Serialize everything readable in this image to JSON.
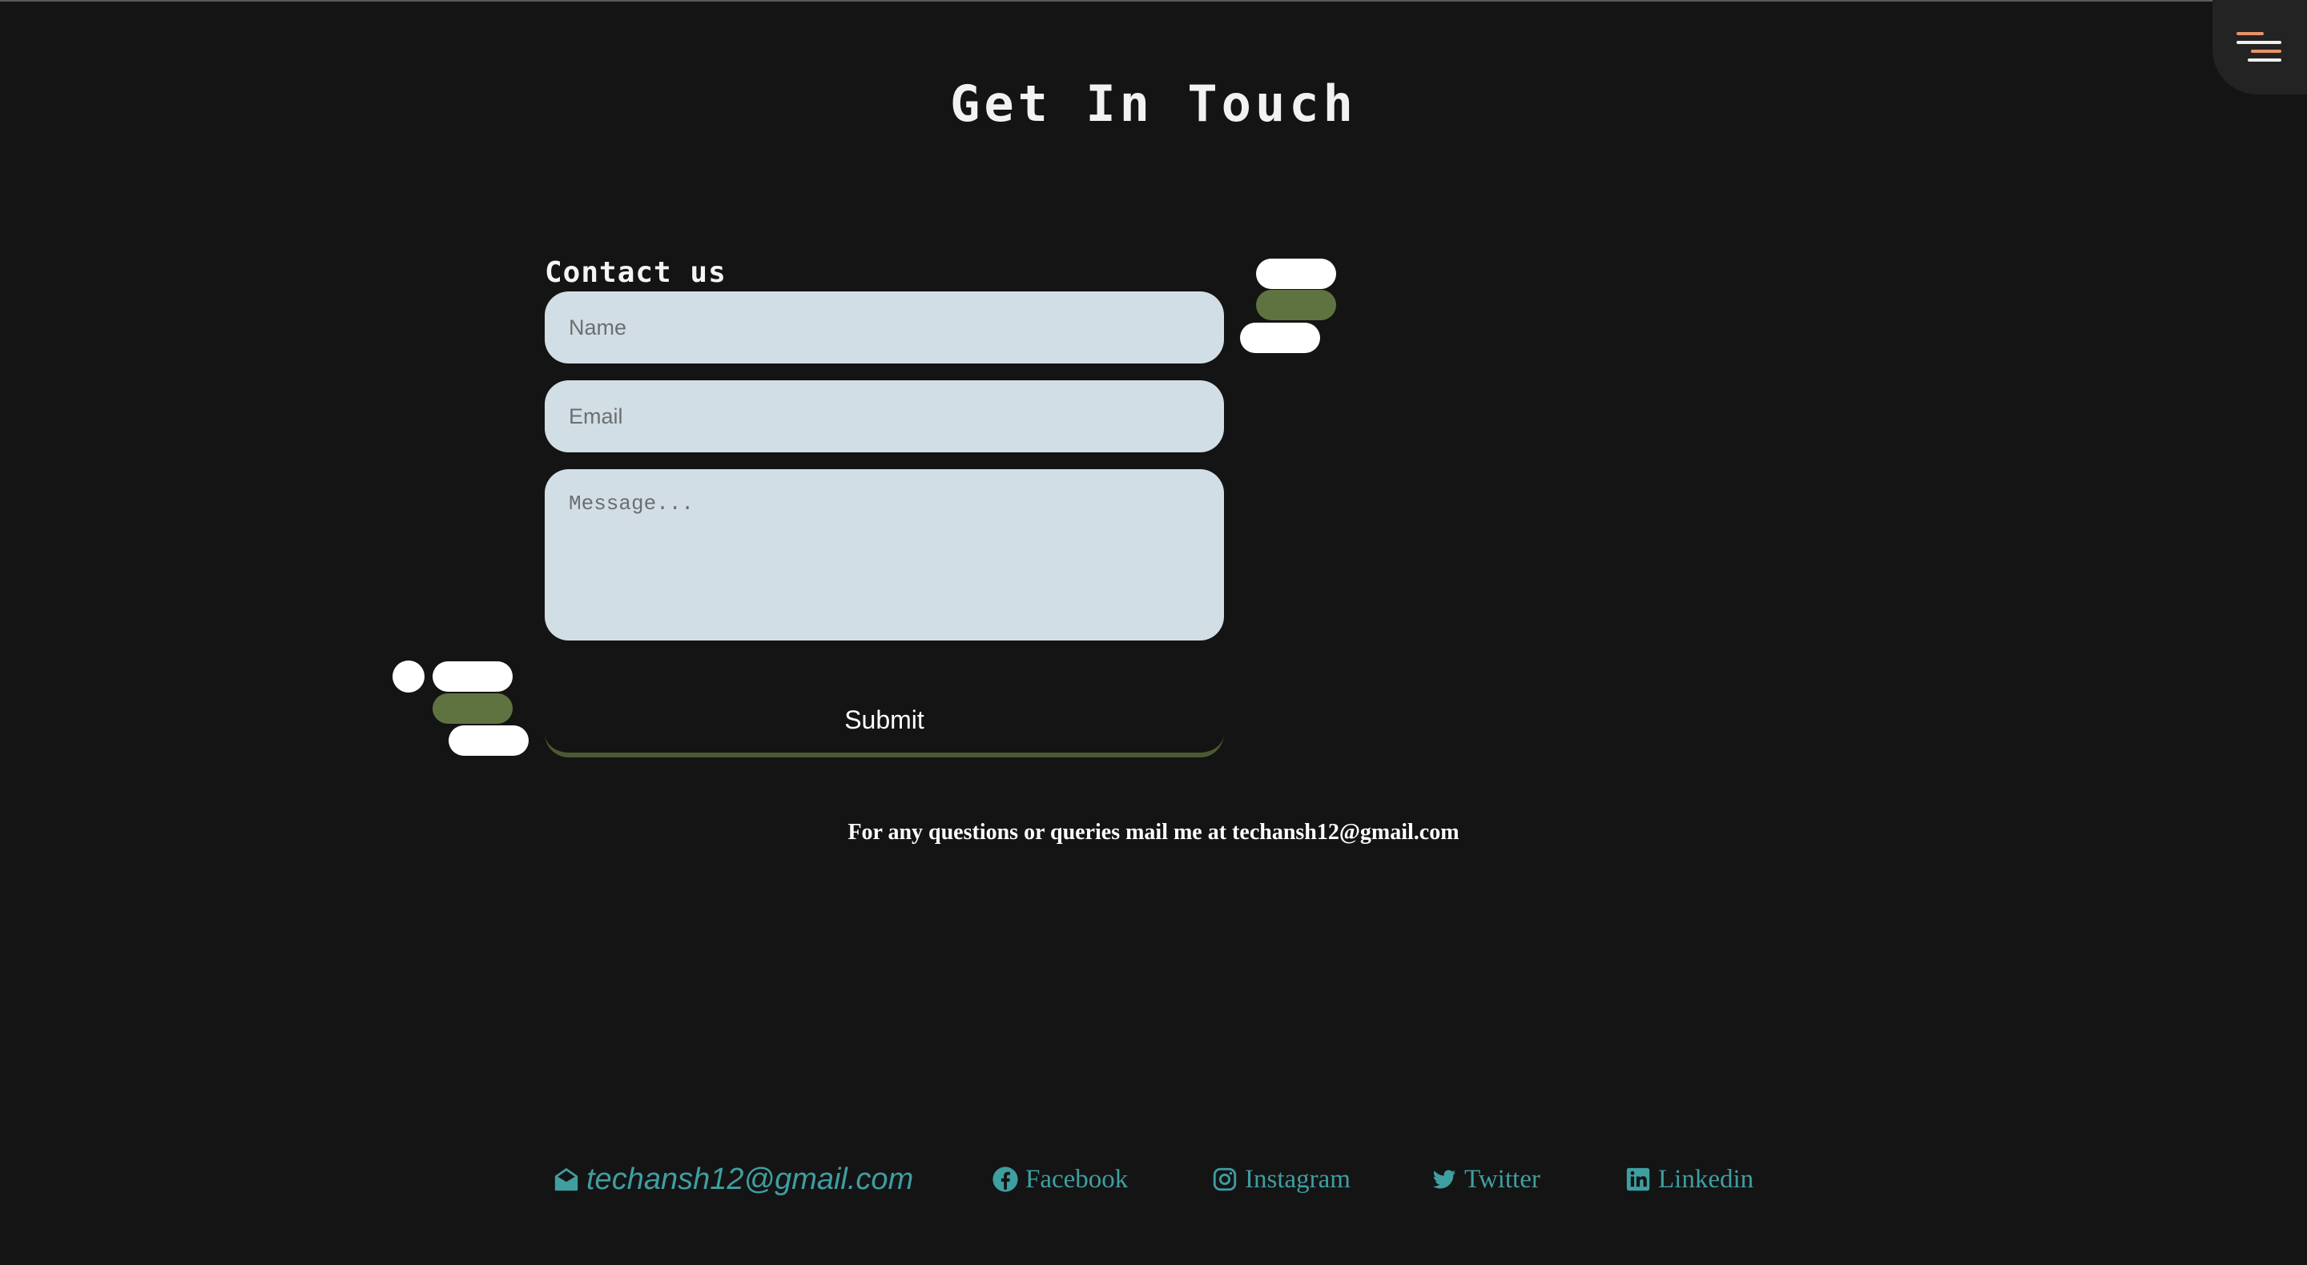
{
  "header": {
    "title": "Get In Touch"
  },
  "menu": {
    "icon": "menu-icon",
    "colors": [
      "#e8936a",
      "#f0f0f0",
      "#e8936a"
    ]
  },
  "form": {
    "label": "Contact us",
    "name_placeholder": "Name",
    "email_placeholder": "Email",
    "message_placeholder": "Message...",
    "submit_label": "Submit"
  },
  "info": {
    "query_text": "For any questions or queries mail me at techansh12@gmail.com"
  },
  "footer": {
    "email": {
      "icon": "envelope-open-icon",
      "label": "techansh12@gmail.com"
    },
    "links": [
      {
        "icon": "facebook-icon",
        "label": "Facebook"
      },
      {
        "icon": "instagram-icon",
        "label": "Instagram"
      },
      {
        "icon": "twitter-icon",
        "label": "Twitter"
      },
      {
        "icon": "linkedin-icon",
        "label": "Linkedin"
      }
    ]
  },
  "colors": {
    "background": "#141414",
    "field_background": "#d2dee5",
    "accent_green": "#5f7340",
    "link": "#3f9ea0"
  }
}
